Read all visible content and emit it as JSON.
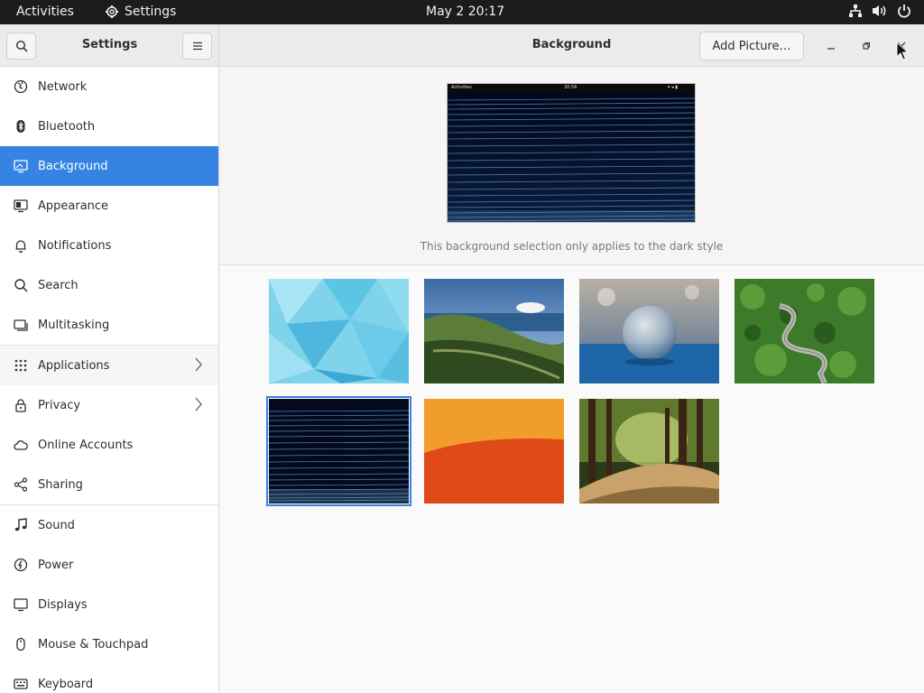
{
  "topbar": {
    "activities": "Activities",
    "app_name": "Settings",
    "clock": "May 2  20:17"
  },
  "sidebar": {
    "title": "Settings",
    "items": [
      {
        "label": "Network",
        "icon": "network-icon"
      },
      {
        "label": "Bluetooth",
        "icon": "bluetooth-icon"
      },
      {
        "label": "Background",
        "icon": "background-icon",
        "selected": true
      },
      {
        "label": "Appearance",
        "icon": "appearance-icon"
      },
      {
        "label": "Notifications",
        "icon": "bell-icon"
      },
      {
        "label": "Search",
        "icon": "search-icon"
      },
      {
        "label": "Multitasking",
        "icon": "multitasking-icon"
      },
      {
        "label": "Applications",
        "icon": "apps-grid-icon",
        "chevron": true
      },
      {
        "label": "Privacy",
        "icon": "lock-icon",
        "chevron": true
      },
      {
        "label": "Online Accounts",
        "icon": "cloud-icon"
      },
      {
        "label": "Sharing",
        "icon": "share-icon"
      },
      {
        "label": "Sound",
        "icon": "music-note-icon"
      },
      {
        "label": "Power",
        "icon": "power-icon"
      },
      {
        "label": "Displays",
        "icon": "display-icon"
      },
      {
        "label": "Mouse & Touchpad",
        "icon": "mouse-icon"
      },
      {
        "label": "Keyboard",
        "icon": "keyboard-icon"
      }
    ]
  },
  "header": {
    "title": "Background",
    "add_picture": "Add Picture…"
  },
  "preview": {
    "caption": "This background selection only applies to the dark style",
    "mini_activities": "Activities",
    "mini_clock": "20:56"
  },
  "gallery": {
    "wallpapers": [
      {
        "name": "blue-triangles"
      },
      {
        "name": "coastal-hills"
      },
      {
        "name": "crystal-ball"
      },
      {
        "name": "forest-road-aerial"
      },
      {
        "name": "dark-blue-lines",
        "selected": true
      },
      {
        "name": "orange-red-curve"
      },
      {
        "name": "forest-path"
      }
    ]
  },
  "colors": {
    "accent": "#3584e4",
    "topbar": "#1c1c1c",
    "headerbar": "#ebebeb"
  }
}
